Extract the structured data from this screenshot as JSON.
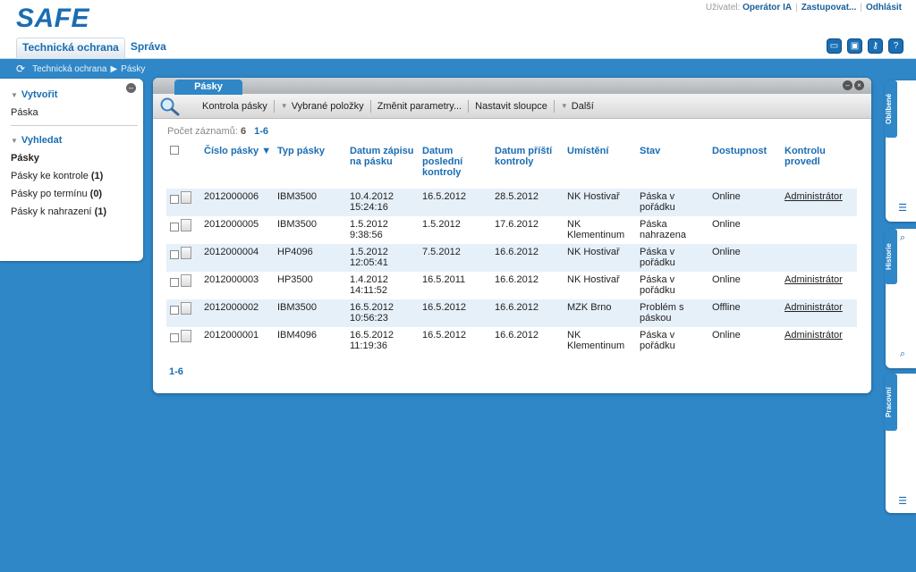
{
  "app": {
    "logo": "SAFE"
  },
  "userbar": {
    "label": "Uživatel:",
    "user": "Operátor IA",
    "deputy": "Zastupovat...",
    "logout": "Odhlásit"
  },
  "nav": {
    "tabs": [
      "Technická ochrana",
      "Správa"
    ]
  },
  "header_icons": [
    "window-icon",
    "windows-icon",
    "key-icon",
    "help-icon"
  ],
  "breadcrumb": {
    "root": "Technická ochrana",
    "current": "Pásky"
  },
  "left": {
    "create": {
      "title": "Vytvořit",
      "items": [
        "Páska"
      ]
    },
    "search": {
      "title": "Vyhledat",
      "items": [
        {
          "label": "Pásky",
          "count": ""
        },
        {
          "label": "Pásky ke kontrole",
          "count": "(1)"
        },
        {
          "label": "Pásky po termínu",
          "count": "(0)"
        },
        {
          "label": "Pásky k nahrazení",
          "count": "(1)"
        }
      ]
    }
  },
  "window": {
    "tab": "Pásky",
    "toolbar": {
      "check": "Kontrola pásky",
      "selected": "Vybrané položky",
      "change": "Změnit parametry...",
      "columns": "Nastavit sloupce",
      "more": "Další"
    },
    "count_label": "Počet záznamů:",
    "count_value": "6",
    "count_range": "1-6",
    "pager": "1-6"
  },
  "table": {
    "columns": [
      "Číslo pásky ▼",
      "Typ pásky",
      "Datum zápisu na pásku",
      "Datum poslední kontroly",
      "Datum příští kontroly",
      "Umístění",
      "Stav",
      "Dostupnost",
      "Kontrolu provedl"
    ],
    "rows": [
      [
        "2012000006",
        "IBM3500",
        "10.4.2012 15:24:16",
        "16.5.2012",
        "28.5.2012",
        "NK Hostivař",
        "Páska v pořádku",
        "Online",
        "Administrátor"
      ],
      [
        "2012000005",
        "IBM3500",
        "1.5.2012 9:38:56",
        "1.5.2012",
        "17.6.2012",
        "NK Klementinum",
        "Páska nahrazena",
        "Online",
        ""
      ],
      [
        "2012000004",
        "HP4096",
        "1.5.2012 12:05:41",
        "7.5.2012",
        "16.6.2012",
        "NK Hostivař",
        "Páska v pořádku",
        "Online",
        ""
      ],
      [
        "2012000003",
        "HP3500",
        "1.4.2012 14:11:52",
        "16.5.2011",
        "16.6.2012",
        "NK Hostivař",
        "Páska v pořádku",
        "Online",
        "Administrátor"
      ],
      [
        "2012000002",
        "IBM3500",
        "16.5.2012 10:56:23",
        "16.5.2012",
        "16.6.2012",
        "MZK Brno",
        "Problém s páskou",
        "Offline",
        "Administrátor"
      ],
      [
        "2012000001",
        "IBM4096",
        "16.5.2012 11:19:36",
        "16.5.2012",
        "16.6.2012",
        "NK Klementinum",
        "Páska v pořádku",
        "Online",
        "Administrátor"
      ]
    ]
  },
  "right_tabs": [
    "Oblíbené",
    "Historie",
    "Pracovní"
  ],
  "colors": {
    "accent": "#2f87c8",
    "link": "#1a6db3",
    "row_alt": "#e6f0f9"
  }
}
